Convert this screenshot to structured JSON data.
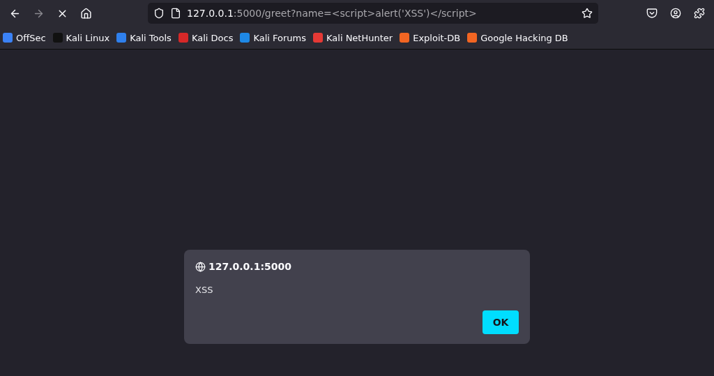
{
  "toolbar": {
    "back": {
      "disabled": false
    },
    "forward": {
      "disabled": true
    },
    "url": {
      "host": "127.0.0.1",
      "rest": ":5000/greet?name=<script>alert('XSS')</script>"
    }
  },
  "bookmarks": [
    {
      "label": "OffSec",
      "color": "#3b82f6"
    },
    {
      "label": "Kali Linux",
      "color": "#111111"
    },
    {
      "label": "Kali Tools",
      "color": "#2f80ed"
    },
    {
      "label": "Kali Docs",
      "color": "#d62828"
    },
    {
      "label": "Kali Forums",
      "color": "#1e88e5"
    },
    {
      "label": "Kali NetHunter",
      "color": "#e53935"
    },
    {
      "label": "Exploit-DB",
      "color": "#f26522"
    },
    {
      "label": "Google Hacking DB",
      "color": "#f26522"
    }
  ],
  "dialog": {
    "origin": "127.0.0.1:5000",
    "message": "XSS",
    "button": "OK"
  }
}
